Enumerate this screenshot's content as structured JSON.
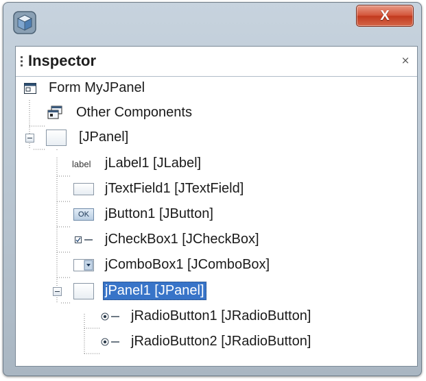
{
  "window": {
    "title": "",
    "close_label": "X"
  },
  "inspector": {
    "title": "Inspector",
    "close_glyph": "⨯"
  },
  "tree": {
    "form": "Form MyJPanel",
    "other_components": "Other Components",
    "root_panel": "[JPanel]",
    "children": [
      {
        "label": "jLabel1 [JLabel]",
        "icon": "label-icon",
        "icon_text": "label"
      },
      {
        "label": "jTextField1 [JTextField]",
        "icon": "textfield-icon"
      },
      {
        "label": "jButton1 [JButton]",
        "icon": "button-icon",
        "icon_text": "OK"
      },
      {
        "label": "jCheckBox1 [JCheckBox]",
        "icon": "checkbox-icon"
      },
      {
        "label": "jComboBox1 [JComboBox]",
        "icon": "combobox-icon"
      },
      {
        "label": "jPanel1 [JPanel]",
        "icon": "panel-icon",
        "selected": true
      }
    ],
    "radio_children": [
      {
        "label": "jRadioButton1 [JRadioButton]",
        "icon": "radiobutton-icon"
      },
      {
        "label": "jRadioButton2 [JRadioButton]",
        "icon": "radiobutton-icon"
      }
    ]
  },
  "colors": {
    "selection": "#3874c8",
    "close_button": "#c9462a",
    "window_frame": "#b9c6d2"
  }
}
